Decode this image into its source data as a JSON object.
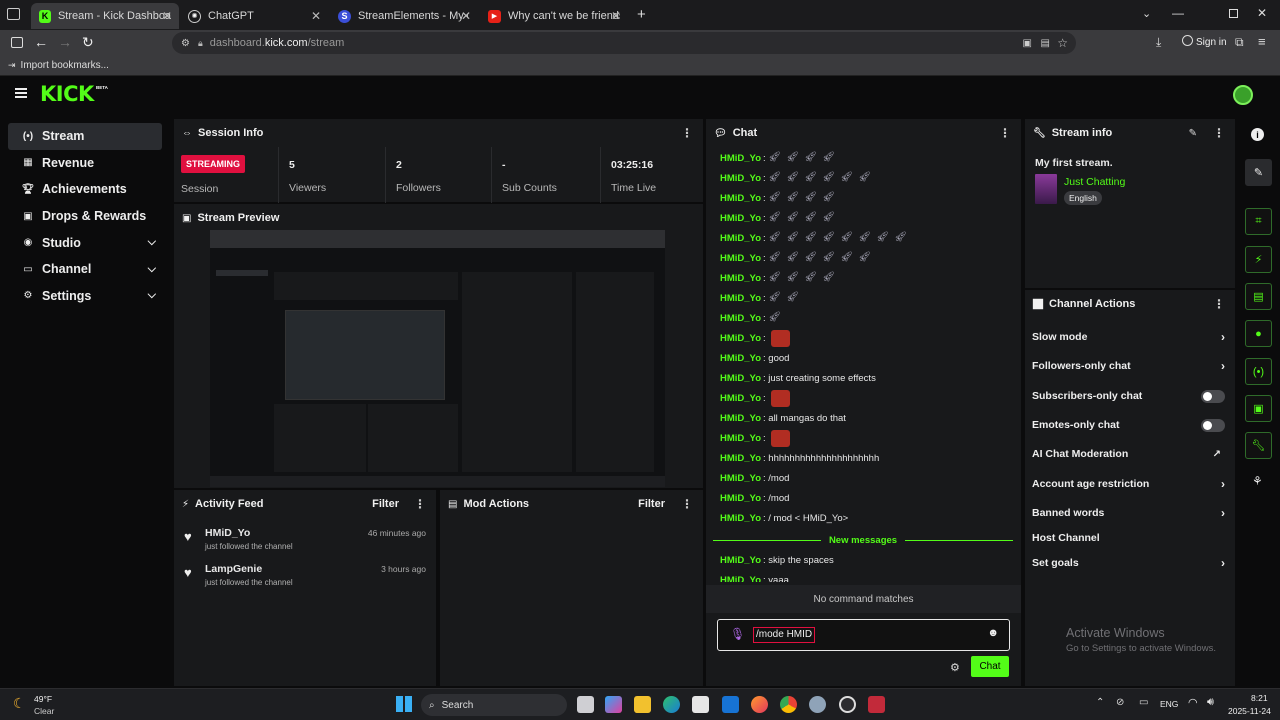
{
  "browser": {
    "tabs": [
      {
        "title": "Stream - Kick Dashboard",
        "active": true,
        "icon": "kick-icon"
      },
      {
        "title": "ChatGPT",
        "active": false,
        "icon": "chatgpt-icon"
      },
      {
        "title": "StreamElements - My dashboar",
        "active": false,
        "icon": "streamelements-icon"
      },
      {
        "title": "Why can't we be friends - Bridg",
        "active": false,
        "icon": "youtube-icon"
      }
    ],
    "url_prefix": "dashboard.",
    "url_domain": "kick.com",
    "url_path": "/stream",
    "sign_in": "Sign in",
    "bookmark": "Import bookmarks..."
  },
  "app": {
    "logo": "KICK",
    "logo_badge": "BETA"
  },
  "sidenav": {
    "items": [
      {
        "label": "Stream",
        "icon": "stream-icon",
        "selected": true
      },
      {
        "label": "Revenue",
        "icon": "revenue-icon"
      },
      {
        "label": "Achievements",
        "icon": "trophy-icon"
      },
      {
        "label": "Drops & Rewards",
        "icon": "gift-icon"
      },
      {
        "label": "Studio",
        "icon": "studio-icon",
        "expand": true
      },
      {
        "label": "Channel",
        "icon": "channel-icon",
        "expand": true
      },
      {
        "label": "Settings",
        "icon": "gear-icon",
        "expand": true
      }
    ]
  },
  "session": {
    "title": "Session Info",
    "badge": "STREAMING",
    "badge_label": "Session",
    "stats": [
      {
        "value": "5",
        "label": "Viewers"
      },
      {
        "value": "2",
        "label": "Followers"
      },
      {
        "value": "-",
        "label": "Sub Counts"
      },
      {
        "value": "03:25:16",
        "label": "Time Live"
      }
    ]
  },
  "preview": {
    "title": "Stream Preview"
  },
  "activity": {
    "title": "Activity Feed",
    "filter": "Filter",
    "items": [
      {
        "name": "HMiD_Yo",
        "desc": "just followed the channel",
        "time": "46 minutes ago"
      },
      {
        "name": "LampGenie",
        "desc": "just followed the channel",
        "time": "3 hours ago"
      }
    ]
  },
  "mod": {
    "title": "Mod Actions",
    "filter": "Filter"
  },
  "chat": {
    "title": "Chat",
    "user": "HMiD_Yo",
    "lines": [
      {
        "text": "",
        "emotes": 4
      },
      {
        "text": "",
        "emotes": 6
      },
      {
        "text": "",
        "emotes": 4
      },
      {
        "text": "",
        "emotes": 4
      },
      {
        "text": "",
        "emotes": 8
      },
      {
        "text": "",
        "emotes": 6
      },
      {
        "text": "",
        "emotes": 4
      },
      {
        "text": "",
        "emotes": 2
      },
      {
        "text": "",
        "emotes": 1
      },
      {
        "text": "",
        "red": true
      },
      {
        "text": "good"
      },
      {
        "text": "just creating some effects"
      },
      {
        "text": "",
        "red": true
      },
      {
        "text": "all mangas do that"
      },
      {
        "text": "",
        "red": true
      },
      {
        "text": "hhhhhhhhhhhhhhhhhhhhh"
      },
      {
        "text": "/mod"
      },
      {
        "text": "/mod"
      },
      {
        "text": "/ mod < HMiD_Yo>"
      }
    ],
    "new_messages": "New messages",
    "after_lines": [
      {
        "text": "skip the spaces"
      },
      {
        "text": "yaaa"
      }
    ],
    "no_match": "No command matches",
    "input_value": "/mode HMID",
    "send": "Chat"
  },
  "stream_info": {
    "title": "Stream info",
    "stream_title": "My first stream.",
    "category": "Just Chatting",
    "language": "English"
  },
  "channel_actions": {
    "title": "Channel Actions",
    "items": [
      {
        "label": "Slow mode",
        "type": "chevron"
      },
      {
        "label": "Followers-only chat",
        "type": "chevron"
      },
      {
        "label": "Subscribers-only chat",
        "type": "toggle"
      },
      {
        "label": "Emotes-only chat",
        "type": "toggle"
      },
      {
        "label": "AI Chat Moderation",
        "type": "external"
      },
      {
        "label": "Account age restriction",
        "type": "chevron"
      },
      {
        "label": "Banned words",
        "type": "chevron"
      },
      {
        "label": "Host Channel",
        "type": "none"
      },
      {
        "label": "Set goals",
        "type": "chevron"
      }
    ]
  },
  "watermark": {
    "line1": "Activate Windows",
    "line2": "Go to Settings to activate Windows."
  },
  "taskbar": {
    "weather_temp": "49°F",
    "weather_desc": "Clear",
    "search": "Search",
    "lang": "ENG",
    "time": "8:21",
    "date": "2025-11-24"
  },
  "colors": {
    "accent": "#53fc18",
    "streaming": "#e0103f"
  }
}
